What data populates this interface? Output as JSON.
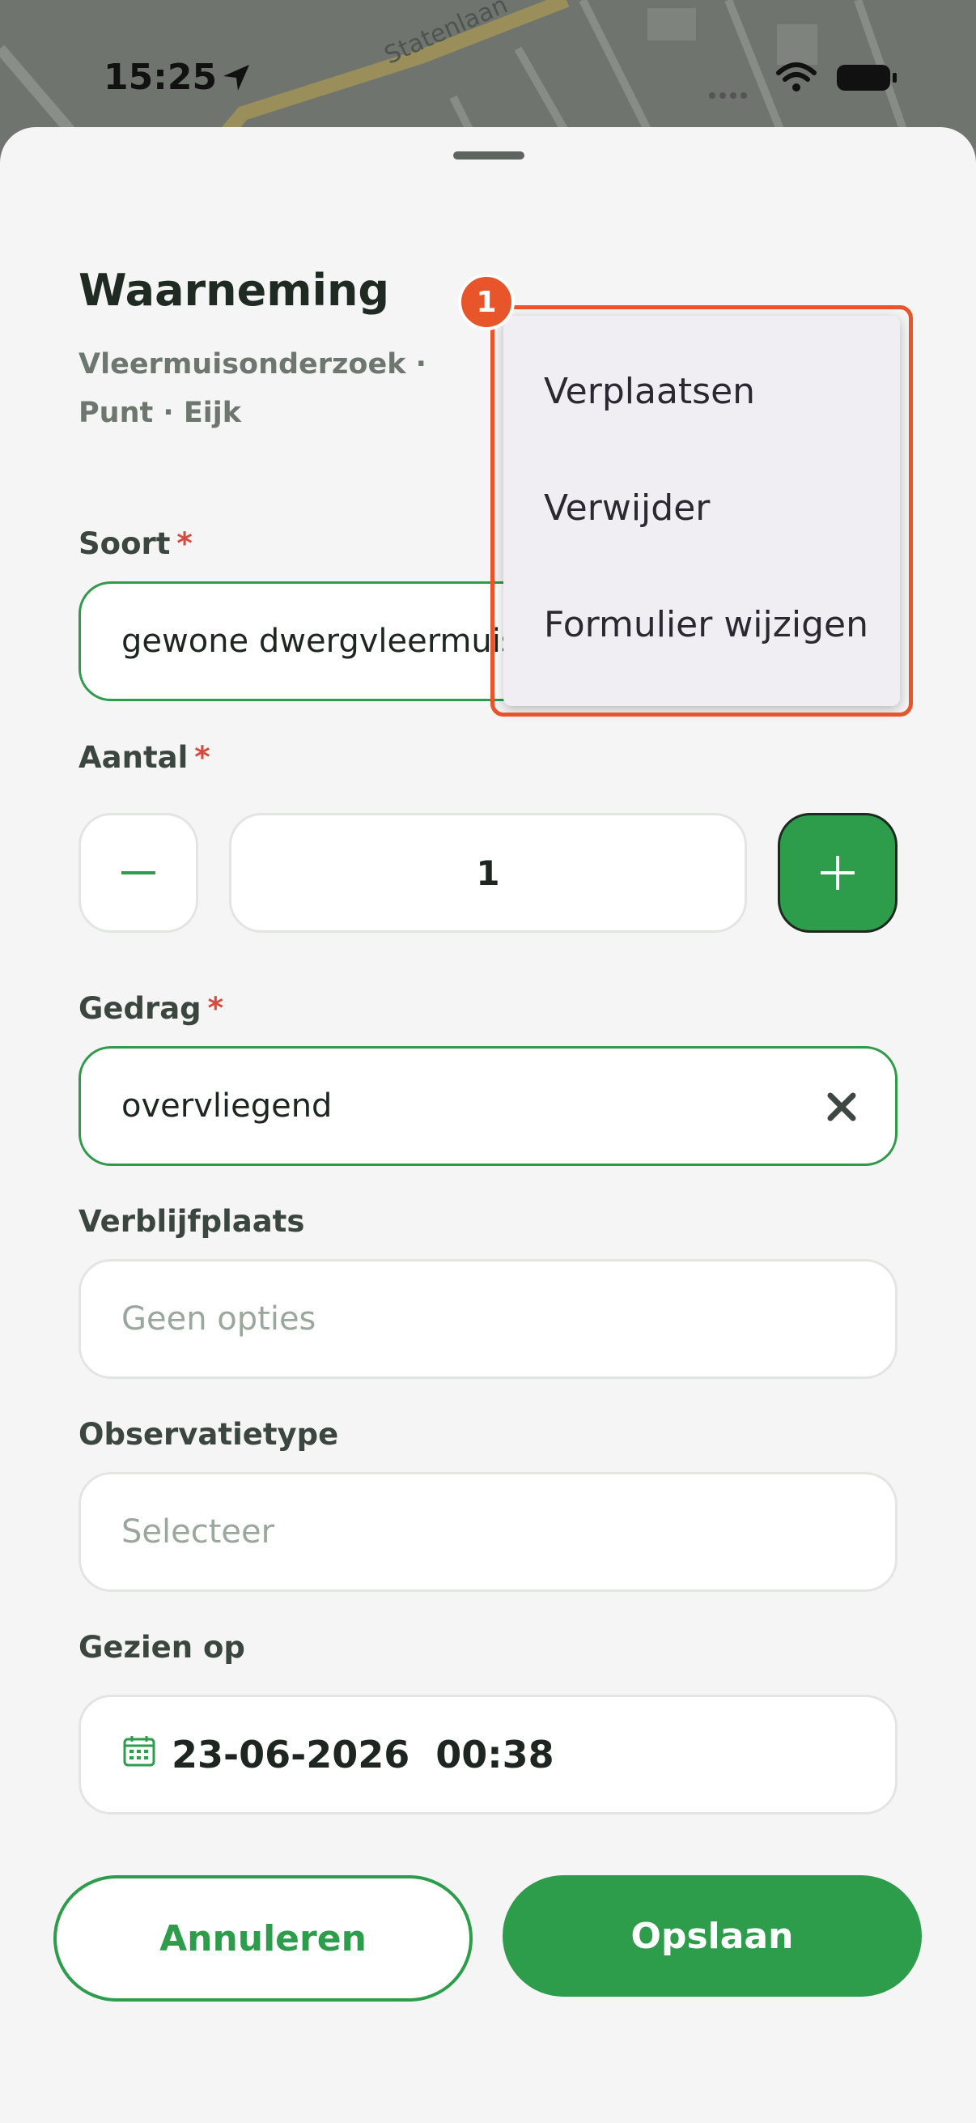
{
  "status_bar": {
    "time": "15:25"
  },
  "map": {
    "street_label": "Statenlaan"
  },
  "sheet": {
    "title": "Waarneming",
    "subtitle": "Vleermuisonderzoek · Punt · Eijk"
  },
  "form": {
    "soort": {
      "label": "Soort",
      "required": "*",
      "value": "gewone dwergvleermuis"
    },
    "aantal": {
      "label": "Aantal",
      "required": "*",
      "value": "1"
    },
    "gedrag": {
      "label": "Gedrag",
      "required": "*",
      "value": "overvliegend"
    },
    "verblijfplaats": {
      "label": "Verblijfplaats",
      "placeholder": "Geen opties"
    },
    "observatietype": {
      "label": "Observatietype",
      "placeholder": "Selecteer"
    },
    "gezien_op": {
      "label": "Gezien op",
      "value": "23-06-2026  00:38"
    }
  },
  "actions": {
    "cancel": "Annuleren",
    "save": "Opslaan"
  },
  "menu": {
    "badge": "1",
    "items": [
      "Verplaatsen",
      "Verwijder",
      "Formulier wijzigen"
    ]
  },
  "colors": {
    "accent": "#2d9c4b",
    "highlight": "#e8552b",
    "required": "#d84a3f"
  }
}
